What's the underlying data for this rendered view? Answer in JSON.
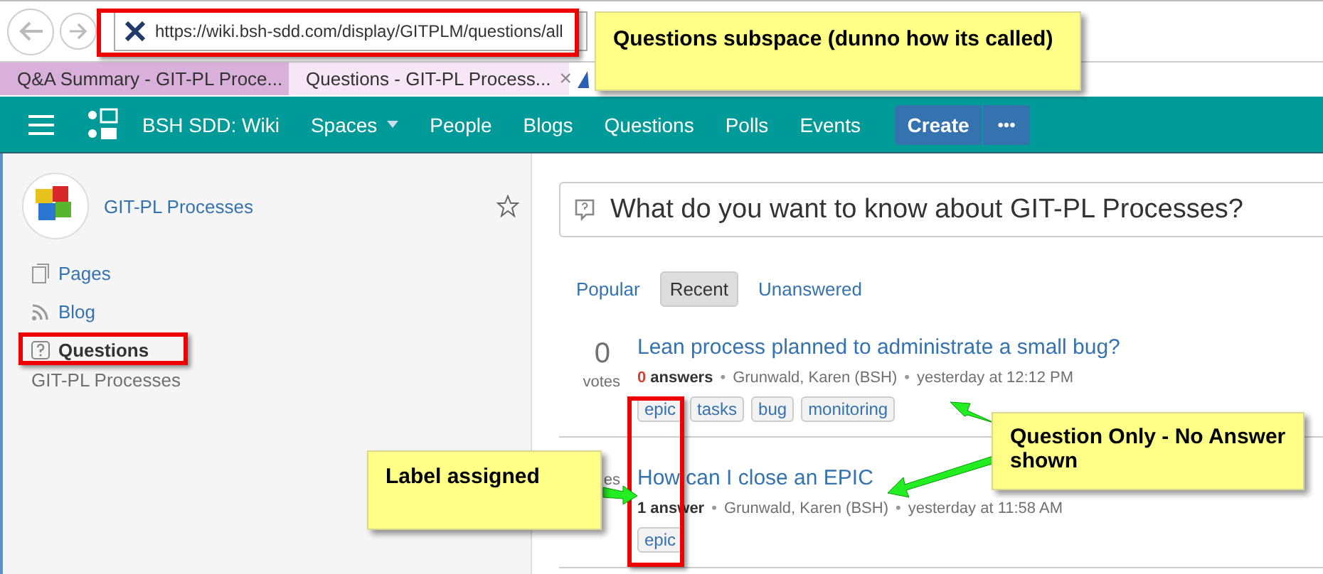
{
  "browser": {
    "url": "https://wiki.bsh-sdd.com/display/GITPLM/questions/all",
    "tabs": [
      {
        "title": "Q&A Summary - GIT-PL Proce...",
        "selected": false
      },
      {
        "title": "Questions - GIT-PL Process...",
        "selected": true,
        "close": "×"
      }
    ]
  },
  "nav": {
    "site": "BSH SDD: Wiki",
    "items": [
      {
        "label": "Spaces",
        "dropdown": true
      },
      {
        "label": "People",
        "dropdown": false
      },
      {
        "label": "Blogs",
        "dropdown": false
      },
      {
        "label": "Questions",
        "dropdown": false
      },
      {
        "label": "Polls",
        "dropdown": false
      },
      {
        "label": "Events",
        "dropdown": false
      }
    ],
    "create": "Create",
    "more": "•••"
  },
  "sidebar": {
    "space": "GIT-PL Processes",
    "items": [
      {
        "label": "Pages",
        "kind": "pages",
        "selected": false
      },
      {
        "label": "Blog",
        "kind": "blog",
        "selected": false
      },
      {
        "label": "Questions",
        "kind": "questions",
        "selected": true
      }
    ],
    "footer": "GIT-PL Processes"
  },
  "search": {
    "placeholder": "What do you want to know about GIT-PL Processes?"
  },
  "filters": [
    {
      "label": "Popular",
      "selected": false
    },
    {
      "label": "Recent",
      "selected": true
    },
    {
      "label": "Unanswered",
      "selected": false
    }
  ],
  "questions": [
    {
      "votes": "0",
      "votes_label": "votes",
      "title": "Lean process planned to administrate a small bug?",
      "answer_count": "0",
      "answered": false,
      "answers_label": "answers",
      "separator": "•",
      "author": "Grunwald, Karen (BSH)",
      "time": "yesterday at 12:12 PM",
      "tags": [
        "epic",
        "tasks",
        "bug",
        "monitoring"
      ]
    },
    {
      "votes_label": "es",
      "title": "How can I close an EPIC",
      "answer_count": "1",
      "answered": true,
      "answers_label": "answer",
      "separator": "•",
      "author": "Grunwald, Karen (BSH)",
      "time": "yesterday at 11:58 AM",
      "tags": [
        "epic"
      ]
    }
  ],
  "annotations": [
    "Questions subspace (dunno how its called)",
    "Question Only - No Answer shown",
    "Label assigned"
  ]
}
